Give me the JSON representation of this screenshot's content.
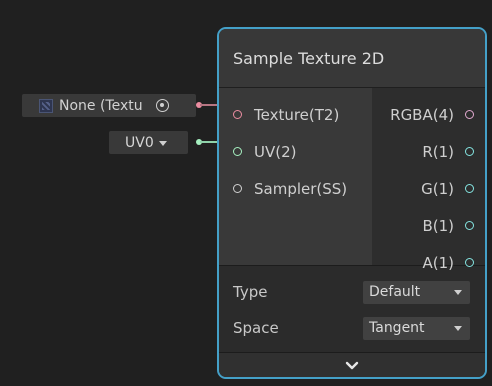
{
  "stubs": {
    "texture_value": "None (Textu",
    "uv_value": "UV0"
  },
  "node": {
    "title": "Sample Texture 2D",
    "inputs": [
      {
        "label": "Texture(T2)",
        "color": "#ea8ca0"
      },
      {
        "label": "UV(2)",
        "color": "#a6f0c0"
      },
      {
        "label": "Sampler(SS)",
        "color": "#d0d0d0"
      }
    ],
    "outputs": [
      {
        "label": "RGBA(4)",
        "color": "#e0a8ce"
      },
      {
        "label": "R(1)",
        "color": "#84e4e0"
      },
      {
        "label": "G(1)",
        "color": "#84e4e0"
      },
      {
        "label": "B(1)",
        "color": "#84e4e0"
      },
      {
        "label": "A(1)",
        "color": "#84e4e0"
      }
    ],
    "controls": {
      "type_label": "Type",
      "type_value": "Default",
      "space_label": "Space",
      "space_value": "Tangent"
    }
  },
  "colors": {
    "node_border": "#44a0c8",
    "texture_wire": "#b77582",
    "uv_wire": "#8fd3aa"
  }
}
